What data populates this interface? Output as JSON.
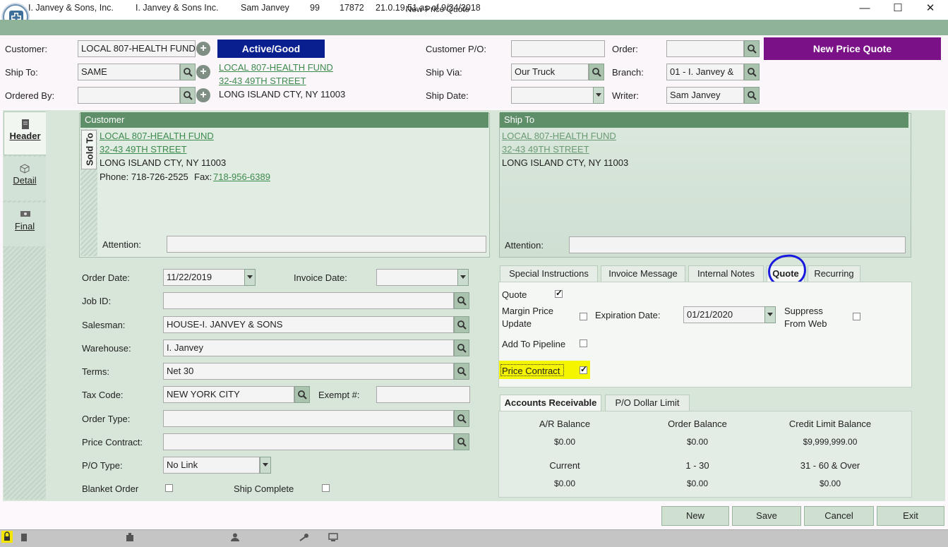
{
  "window": {
    "title": "New Price Quote",
    "min": "—",
    "max": "☐",
    "close": "✕"
  },
  "top": {
    "customer_label": "Customer:",
    "customer_value": "LOCAL 807-HEALTH FUND",
    "status_badge": "Active/Good",
    "ship_to_label": "Ship To:",
    "ship_to_value": "SAME",
    "ordered_by_label": "Ordered By:",
    "ordered_by_value": "",
    "address_line1": "LOCAL 807-HEALTH FUND",
    "address_line2": "32-43 49TH STREET",
    "address_line3": "LONG ISLAND CTY, NY 11003",
    "customer_po_label": "Customer P/O:",
    "customer_po_value": "",
    "ship_via_label": "Ship Via:",
    "ship_via_value": "Our Truck",
    "ship_date_label": "Ship Date:",
    "ship_date_value": "",
    "order_label": "Order:",
    "order_value": "",
    "branch_label": "Branch:",
    "branch_value": "01 - I. Janvey &",
    "writer_label": "Writer:",
    "writer_value": "Sam Janvey",
    "doc_badge": "New Price Quote"
  },
  "left_tabs": [
    {
      "label": "Header",
      "icon": "document-icon"
    },
    {
      "label": "Detail",
      "icon": "cube-icon"
    },
    {
      "label": "Final",
      "icon": "money-icon"
    }
  ],
  "customer_panel": {
    "header": "Customer",
    "side_label": "Sold To",
    "name": "LOCAL 807-HEALTH FUND",
    "street": "32-43 49TH STREET",
    "city": "LONG ISLAND CTY, NY 11003",
    "phone": "Phone: 718-726-2525",
    "fax_label": "Fax:",
    "fax": "718-956-6389",
    "attention_label": "Attention:",
    "attention_value": ""
  },
  "shipto_panel": {
    "header": "Ship To",
    "name": "LOCAL 807-HEALTH FUND",
    "street": "32-43 49TH STREET",
    "city": "LONG ISLAND CTY, NY 11003",
    "attention_label": "Attention:",
    "attention_value": ""
  },
  "form": {
    "order_date_label": "Order Date:",
    "order_date_value": "11/22/2019",
    "invoice_date_label": "Invoice Date:",
    "invoice_date_value": "",
    "job_id_label": "Job ID:",
    "job_id_value": "",
    "salesman_label": "Salesman:",
    "salesman_value": "HOUSE-I. JANVEY & SONS",
    "warehouse_label": "Warehouse:",
    "warehouse_value": "I. Janvey",
    "terms_label": "Terms:",
    "terms_value": "Net 30",
    "tax_code_label": "Tax Code:",
    "tax_code_value": "NEW YORK CITY",
    "exempt_label": "Exempt #:",
    "exempt_value": "",
    "order_type_label": "Order Type:",
    "order_type_value": "",
    "price_contract_label": "Price Contract:",
    "price_contract_value": "",
    "po_type_label": "P/O Type:",
    "po_type_value": "No Link",
    "blanket_label": "Blanket Order",
    "ship_complete_label": "Ship Complete"
  },
  "tabs": [
    "Special Instructions",
    "Invoice Message",
    "Internal Notes",
    "Quote",
    "Recurring"
  ],
  "quote": {
    "quote_label": "Quote",
    "quote_checked": true,
    "margin_label_1": "Margin Price",
    "margin_label_2": "Update",
    "margin_checked": false,
    "expiration_label": "Expiration Date:",
    "expiration_value": "01/21/2020",
    "suppress_label_1": "Suppress",
    "suppress_label_2": "From Web",
    "suppress_checked": false,
    "pipeline_label": "Add To Pipeline",
    "pipeline_checked": false,
    "price_contract_label": "Price Contract",
    "price_contract_checked": true
  },
  "ar_tabs": [
    "Accounts Receivable",
    "P/O Dollar Limit"
  ],
  "ar": {
    "ar_balance_label": "A/R Balance",
    "ar_balance": "$0.00",
    "order_balance_label": "Order Balance",
    "order_balance": "$0.00",
    "credit_limit_label": "Credit Limit Balance",
    "credit_limit": "$9,999,999.00",
    "current_label": "Current",
    "current": "$0.00",
    "d1_30_label": "1 - 30",
    "d1_30": "$0.00",
    "d31_label": "31 - 60 & Over",
    "d31": "$0.00"
  },
  "buttons": {
    "new": "New",
    "save": "Save",
    "cancel": "Cancel",
    "exit": "Exit"
  },
  "status": {
    "company1": "I. Janvey & Sons, Inc.",
    "company2": "I. Janvey & Sons Inc.",
    "user": "Sam Janvey",
    "key_count": "99",
    "terminal": "17872",
    "version": "21.0.19.51 as of 9/24/2018"
  },
  "colors": {
    "status_badge": "#0a1f8f",
    "doc_badge": "#7a1187",
    "highlight": "#f5f500",
    "annotation_circle": "#1a1adf"
  }
}
